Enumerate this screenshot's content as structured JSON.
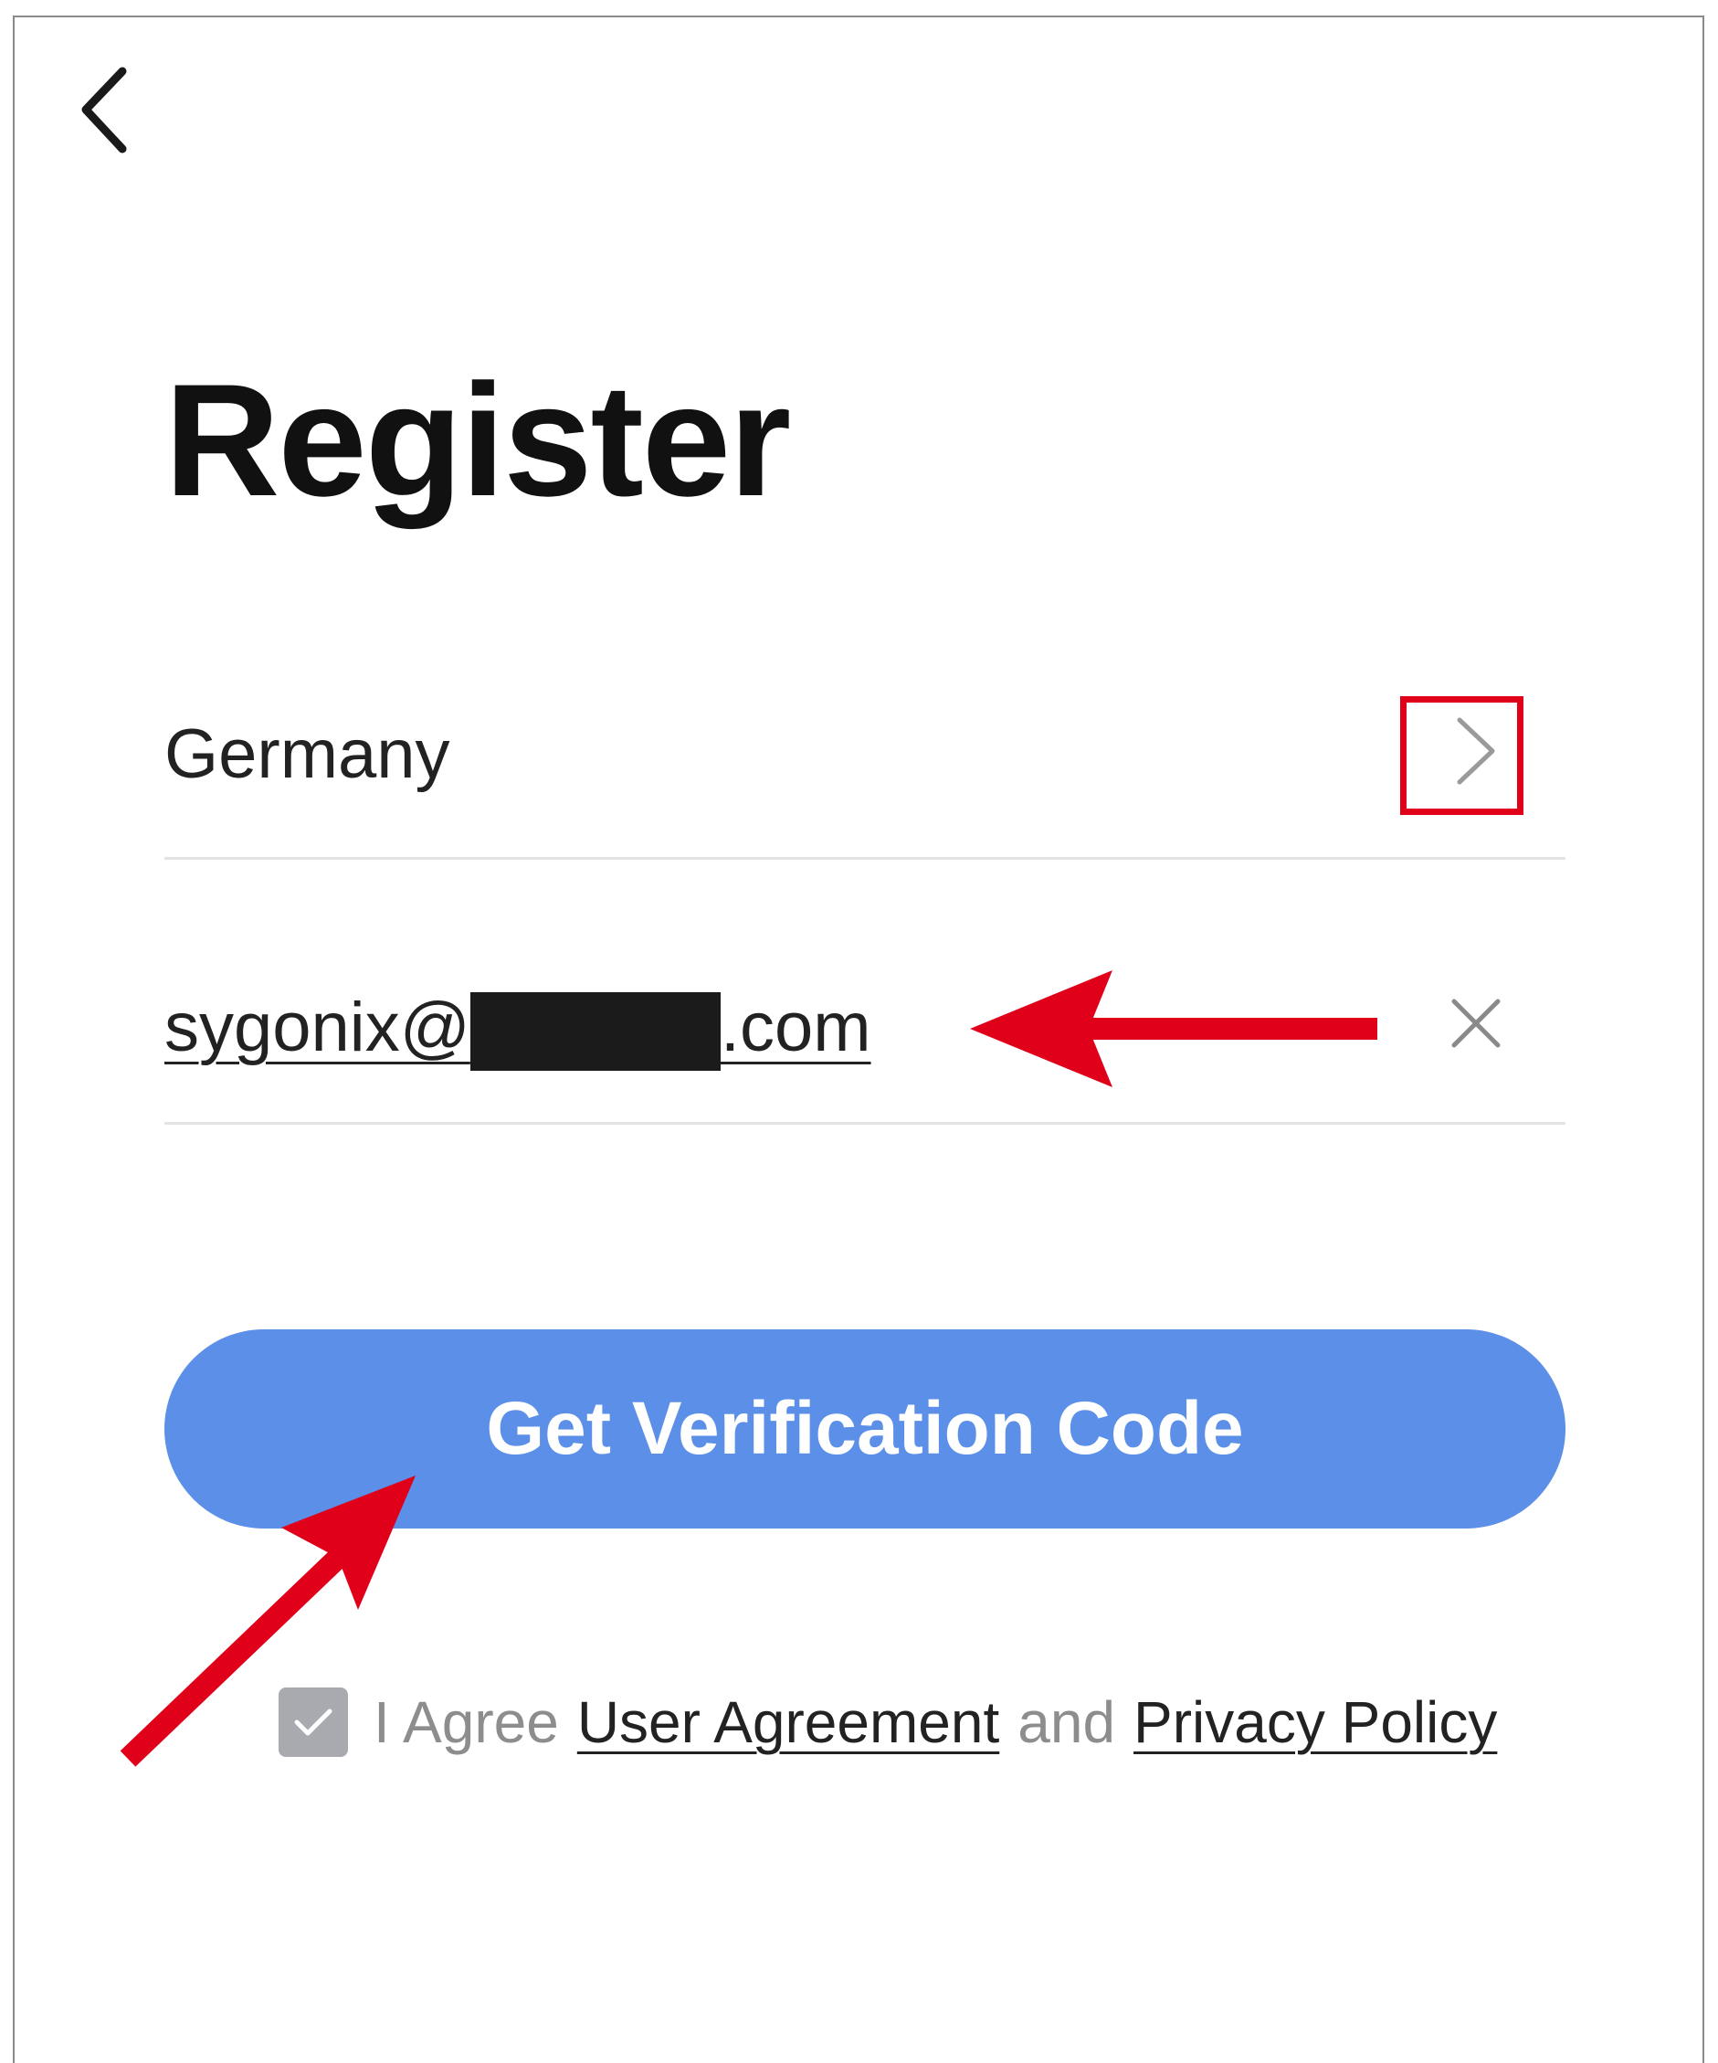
{
  "header": {
    "back_icon": "chevron-left-icon"
  },
  "page": {
    "title": "Register"
  },
  "country_row": {
    "value": "Germany",
    "chevron_icon": "chevron-right-icon"
  },
  "email_row": {
    "value_prefix": "sygonix@",
    "value_suffix": ".com",
    "clear_icon": "close-icon"
  },
  "primary_button": {
    "label": "Get Verification Code",
    "color": "#5b8fe8"
  },
  "agreement": {
    "checked": true,
    "prefix": "I Agree",
    "user_agreement_link": "User Agreement",
    "conjunction": "and",
    "privacy_policy_link": "Privacy Policy"
  },
  "annotations": {
    "highlight_color": "#e0001a",
    "markers": [
      "highlight-box-country-chevron",
      "arrow-to-email-field",
      "arrow-to-verification-button"
    ]
  }
}
